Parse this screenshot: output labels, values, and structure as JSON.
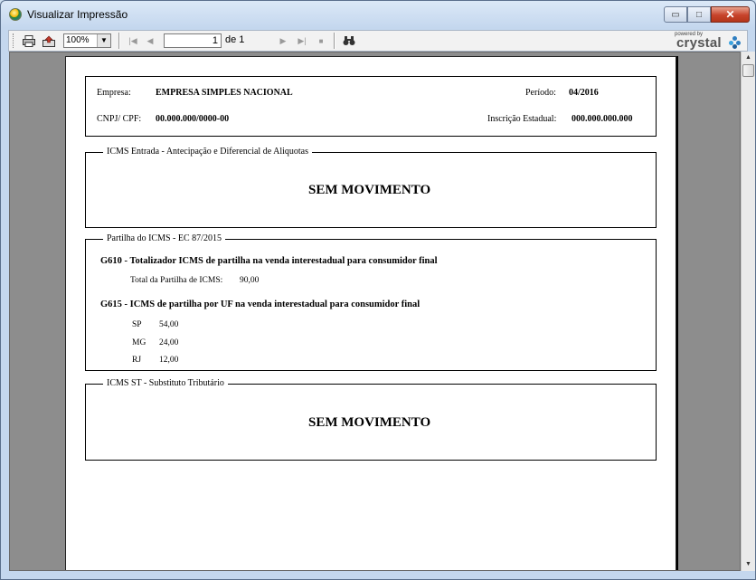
{
  "window": {
    "title": "Visualizar Impressão",
    "minimize_glyph": "▭",
    "maximize_glyph": "□",
    "close_glyph": "✕"
  },
  "toolbar": {
    "print_icon": "print-icon",
    "export_icon": "export-icon",
    "zoom_value": "100%",
    "zoom_arrow": "▼",
    "first_glyph": "|◀",
    "prev_glyph": "◀",
    "page_value": "1",
    "page_of": "de 1",
    "next_glyph": "▶",
    "last_glyph": "▶|",
    "stop_glyph": "■",
    "search_glyph": "🔍",
    "brand_powered": "powered by",
    "brand_name": "crystal"
  },
  "report": {
    "header": {
      "empresa_label": "Empresa:",
      "empresa_value": "EMPRESA SIMPLES NACIONAL",
      "periodo_label": "Período:",
      "periodo_value": "04/2016",
      "cnpj_label": "CNPJ/ CPF:",
      "cnpj_value": "00.000.000/0000-00",
      "ie_label": "Inscrição Estadual:",
      "ie_value": "000.000.000.000"
    },
    "section1": {
      "legend": "ICMS Entrada - Antecipação e Diferencial de Aliquotas",
      "message": "SEM MOVIMENTO"
    },
    "section2": {
      "legend": "Partilha do ICMS - EC 87/2015",
      "g610_title": "G610 - Totalizador ICMS de partilha na venda interestadual para consumidor final",
      "total_label": "Total da Partilha de ICMS:",
      "total_value": "90,00",
      "g615_title": "G615 - ICMS de partilha por UF na venda interestadual para consumidor final",
      "uf_rows": [
        {
          "uf": "SP",
          "value": "54,00"
        },
        {
          "uf": "MG",
          "value": "24,00"
        },
        {
          "uf": "RJ",
          "value": "12,00"
        }
      ]
    },
    "section3": {
      "legend": "ICMS ST - Substituto Tributário",
      "message": "SEM MOVIMENTO"
    }
  },
  "scrollbar": {
    "up_glyph": "▲",
    "down_glyph": "▼"
  }
}
